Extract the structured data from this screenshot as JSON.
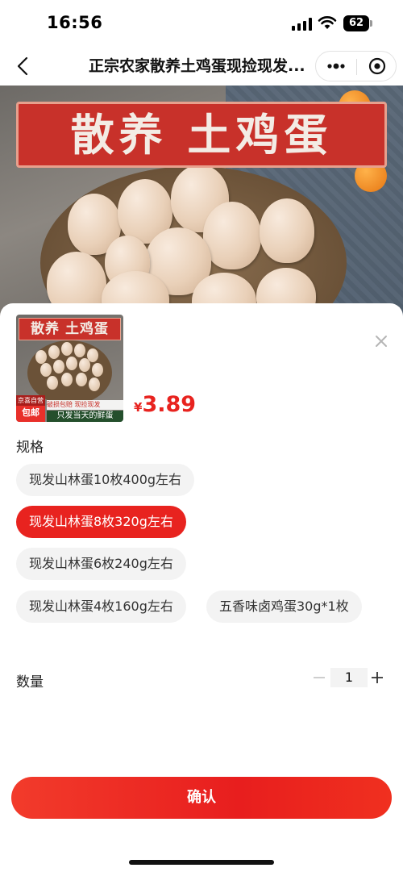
{
  "status_bar": {
    "time": "16:56",
    "battery": "62"
  },
  "nav": {
    "title": "正宗农家散养土鸡蛋现捡现发..."
  },
  "hero": {
    "banner_text": "散养 土鸡蛋"
  },
  "product": {
    "thumb_banner": "散养 土鸡蛋",
    "thumb_badge_top": "京喜自营",
    "thumb_badge_main": "包邮",
    "thumb_tags": "破损包赔 现捡现发",
    "thumb_caption": "只发当天的鲜蛋",
    "price_currency": "¥",
    "price": "3.89"
  },
  "spec": {
    "label": "规格",
    "options": [
      {
        "label": "现发山林蛋10枚400g左右",
        "selected": false
      },
      {
        "label": "现发山林蛋8枚320g左右",
        "selected": true
      },
      {
        "label": "现发山林蛋6枚240g左右",
        "selected": false
      },
      {
        "label": "现发山林蛋4枚160g左右",
        "selected": false
      },
      {
        "label": "五香味卤鸡蛋30g*1枚",
        "selected": false
      }
    ]
  },
  "quantity": {
    "label": "数量",
    "value": "1"
  },
  "confirm": {
    "label": "确认"
  },
  "colors": {
    "accent": "#e8231f",
    "option_bg": "#f3f3f3"
  }
}
